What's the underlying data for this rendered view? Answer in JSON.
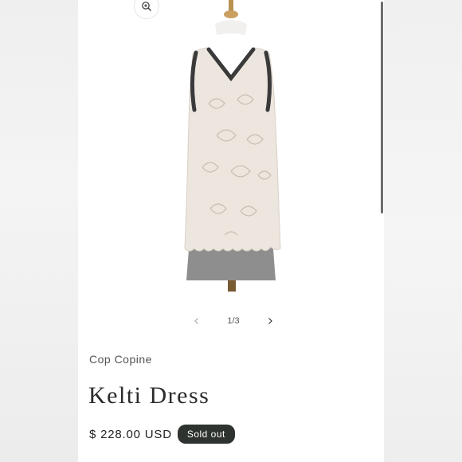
{
  "product": {
    "vendor": "Cop Copine",
    "title": "Kelti Dress",
    "price": "$ 228.00 USD",
    "badge": "Sold out"
  },
  "gallery": {
    "counter": "1/3",
    "current_image": 1,
    "total_images": 3,
    "zoom_icon": "zoom-in-icon",
    "prev_icon": "chevron-left-icon",
    "next_icon": "chevron-right-icon"
  },
  "colors": {
    "badge_bg": "#2e332f",
    "text": "#222222",
    "lace": "#e8e2da",
    "skirt": "#8c8c8c",
    "trim": "#3a3a3a"
  }
}
